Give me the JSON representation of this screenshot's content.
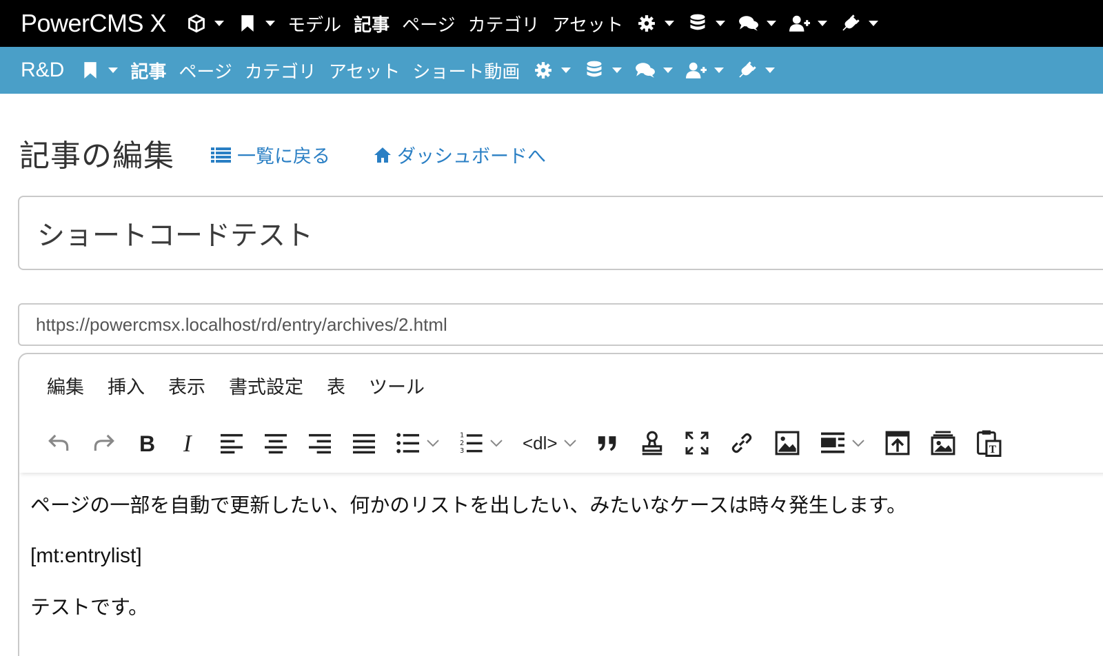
{
  "topbar": {
    "brand": "PowerCMS X",
    "items": [
      {
        "label": "モデル"
      },
      {
        "label": "記事"
      },
      {
        "label": "ページ"
      },
      {
        "label": "カテゴリ"
      },
      {
        "label": "アセット"
      }
    ]
  },
  "subbar": {
    "site": "R&D",
    "items": [
      {
        "label": "記事"
      },
      {
        "label": "ページ"
      },
      {
        "label": "カテゴリ"
      },
      {
        "label": "アセット"
      },
      {
        "label": "ショート動画"
      }
    ]
  },
  "header": {
    "title": "記事の編集",
    "back_link": "一覧に戻る",
    "dashboard_link": "ダッシュボードへ"
  },
  "form": {
    "title_value": "ショートコードテスト",
    "url_value": "https://powercmsx.localhost/rd/entry/archives/2.html"
  },
  "editor": {
    "menus": [
      "編集",
      "挿入",
      "表示",
      "書式設定",
      "表",
      "ツール"
    ],
    "dl_label": "<dl>",
    "paragraphs": [
      "ページの一部を自動で更新したい、何かのリストを出したい、みたいなケースは時々発生します。",
      "[mt:entrylist]",
      "テストです。"
    ]
  },
  "colors": {
    "topbar": "#000000",
    "subbar": "#4a9fc8",
    "link": "#2a7fc4"
  }
}
